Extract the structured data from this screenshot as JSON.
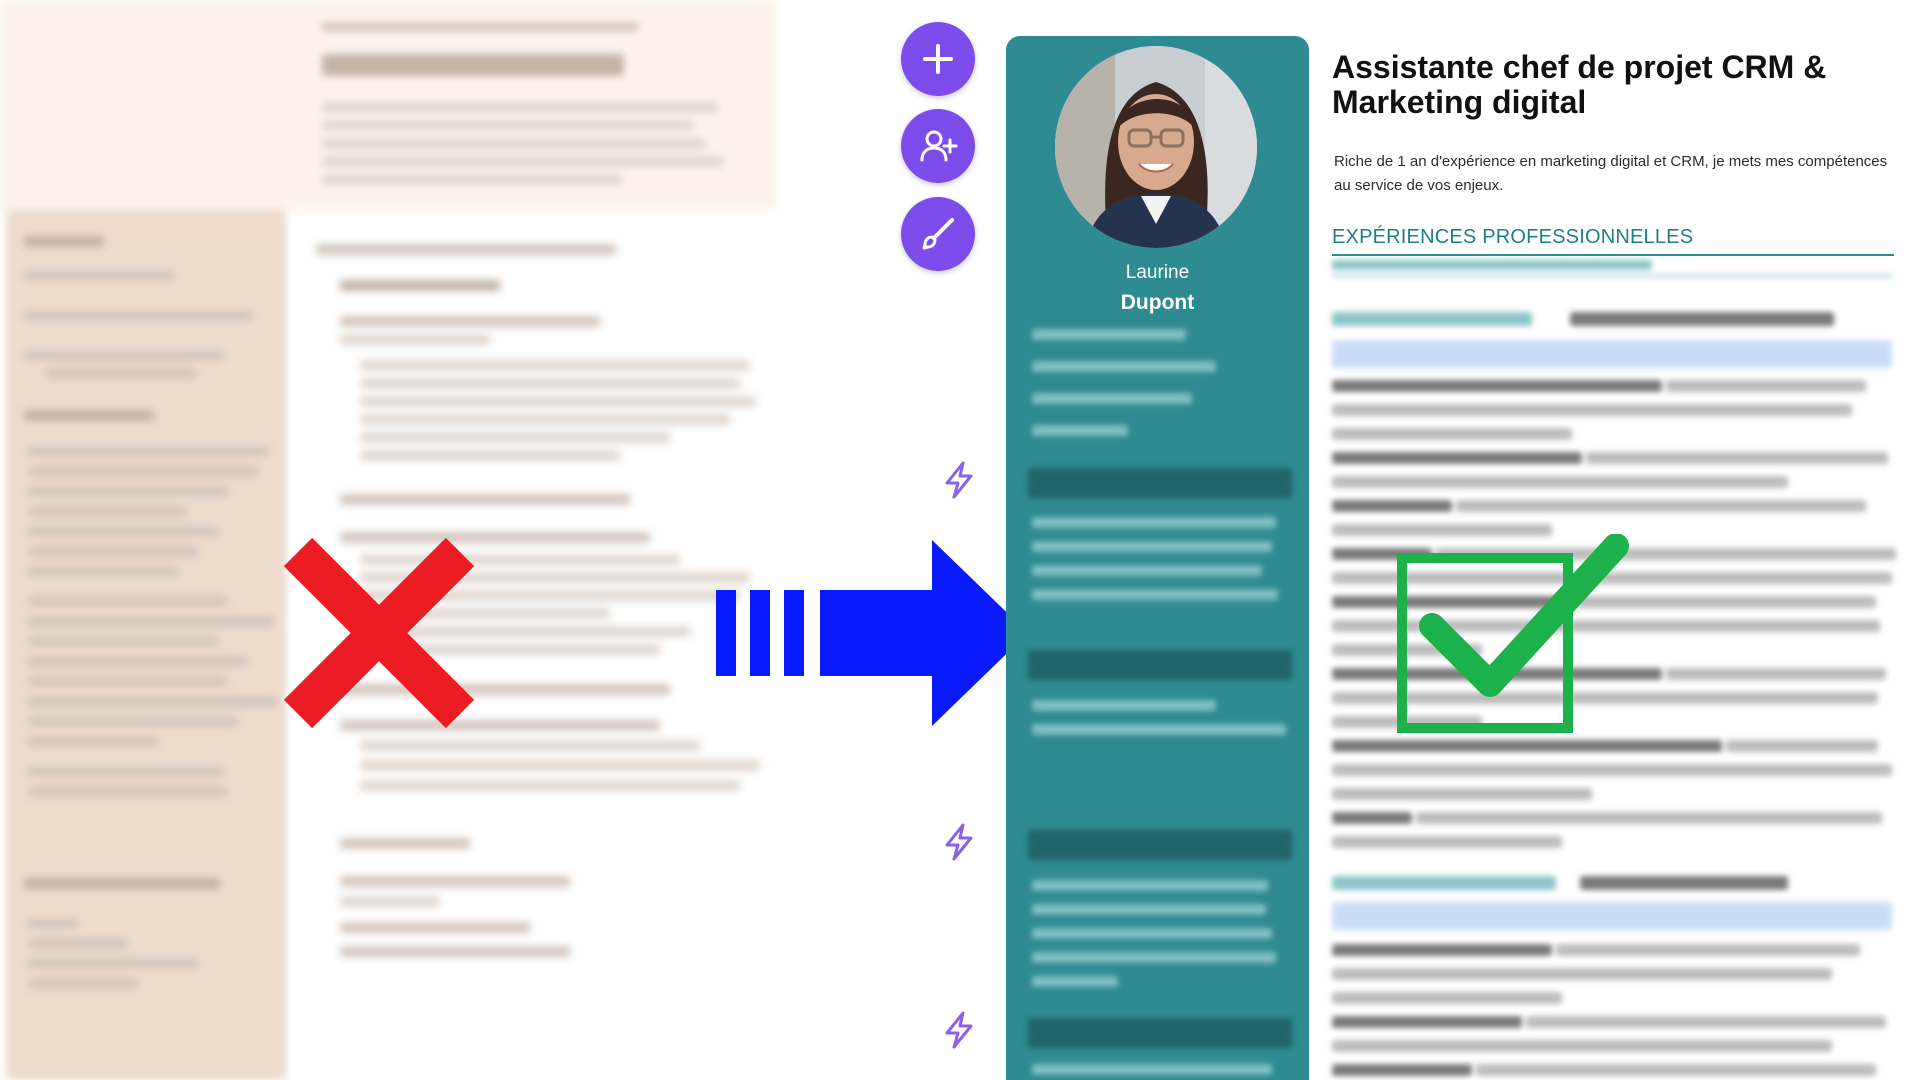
{
  "left_panel": {
    "description_state": "blurred_old_cv"
  },
  "symbols": {
    "reject": "cross-mark-icon",
    "arrow": "right-arrow-icon",
    "approve": "check-mark-icon"
  },
  "colors": {
    "cross": "#ed1c24",
    "arrow": "#0a1aff",
    "check": "#1db14b",
    "button_purple": "#7c4dea",
    "sidebar_teal": "#2e8b91",
    "section_teal": "#1f7f86"
  },
  "toolbar": {
    "buttons": [
      "add-button",
      "add-user-button",
      "edit-brush-button"
    ],
    "bolts": [
      "lightning-icon",
      "lightning-icon",
      "lightning-icon"
    ]
  },
  "resume": {
    "first_name": "Laurine",
    "last_name": "Dupont",
    "title": "Assistante chef de projet CRM & Marketing digital",
    "summary": "Riche de 1 an d'expérience en marketing digital et CRM, je mets mes compétences au service de vos enjeux.",
    "section_experience": "EXPÉRIENCES PROFESSIONNELLES"
  }
}
